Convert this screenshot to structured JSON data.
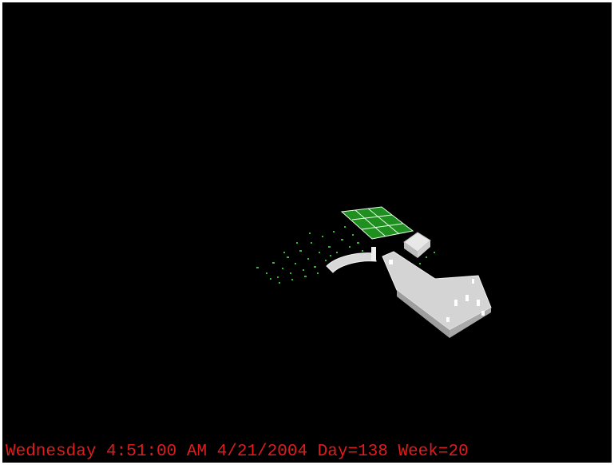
{
  "status": {
    "text": "Wednesday 4:51:00 AM 4/21/2004 Day=138 Week=20"
  },
  "colors": {
    "background": "#000000",
    "status_text": "#e21b1b",
    "field_green": "#1f8f1f",
    "structure_white": "#d8d8d8",
    "plant_green": "#2cbf2c"
  }
}
